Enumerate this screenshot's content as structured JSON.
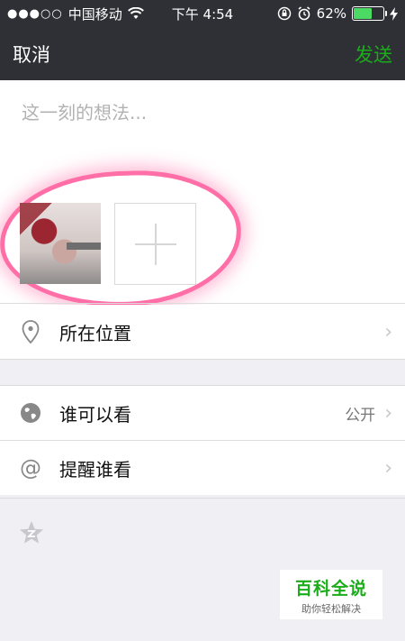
{
  "status_bar": {
    "signal": "●●●○○",
    "carrier": "中国移动",
    "time": "下午 4:54",
    "battery_percent": "62%",
    "battery_level": 0.62
  },
  "nav": {
    "cancel_label": "取消",
    "send_label": "发送"
  },
  "compose": {
    "placeholder": "这一刻的想法..."
  },
  "rows": {
    "location": {
      "label": "所在位置"
    },
    "visibility": {
      "label": "谁可以看",
      "value": "公开"
    },
    "remind": {
      "label": "提醒谁看",
      "icon_text": "@"
    }
  },
  "watermark": {
    "title": "百科全说",
    "subtitle": "助你轻松解决"
  },
  "colors": {
    "accent": "#1aad19",
    "highlight": "#ff6ea7",
    "bar_bg": "#2f3035"
  }
}
